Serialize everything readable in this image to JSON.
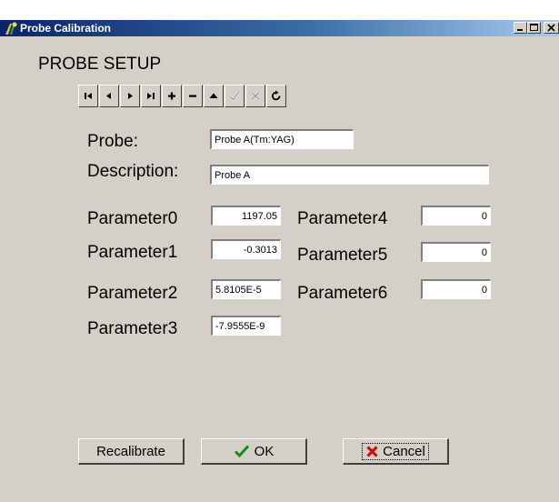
{
  "window": {
    "title": "Probe Calibration"
  },
  "heading": "PROBE SETUP",
  "nav": {
    "buttons": [
      {
        "name": "first-record-button",
        "icon": "first-icon",
        "enabled": true
      },
      {
        "name": "prior-record-button",
        "icon": "prior-icon",
        "enabled": true
      },
      {
        "name": "next-record-button",
        "icon": "next-icon",
        "enabled": true
      },
      {
        "name": "last-record-button",
        "icon": "last-icon",
        "enabled": true
      },
      {
        "name": "insert-record-button",
        "icon": "plus-icon",
        "enabled": true
      },
      {
        "name": "delete-record-button",
        "icon": "minus-icon",
        "enabled": true
      },
      {
        "name": "edit-record-button",
        "icon": "up-triangle-icon",
        "enabled": true
      },
      {
        "name": "post-record-button",
        "icon": "checkmark-icon",
        "enabled": false
      },
      {
        "name": "cancel-edit-button",
        "icon": "x-icon",
        "enabled": false
      },
      {
        "name": "refresh-button",
        "icon": "refresh-icon",
        "enabled": true
      }
    ]
  },
  "probe": {
    "label": "Probe:",
    "value": "Probe A(Tm:YAG)"
  },
  "description": {
    "label": "Description:",
    "value": "Probe A"
  },
  "params": {
    "p0": {
      "label": "Parameter0",
      "value": "1197.05"
    },
    "p1": {
      "label": "Parameter1",
      "value": "-0.3013"
    },
    "p2": {
      "label": "Parameter2",
      "value": "5.8105E-5"
    },
    "p3": {
      "label": "Parameter3",
      "value": "-7.9555E-9"
    },
    "p4": {
      "label": "Parameter4",
      "value": "0"
    },
    "p5": {
      "label": "Parameter5",
      "value": "0"
    },
    "p6": {
      "label": "Parameter6",
      "value": "0"
    }
  },
  "buttons": {
    "recalibrate": "Recalibrate",
    "ok": "OK",
    "cancel": "Cancel"
  },
  "colors": {
    "ok_check": "#1a8a1a",
    "cancel_x": "#cc1111",
    "titlebar": "#0a246a"
  }
}
